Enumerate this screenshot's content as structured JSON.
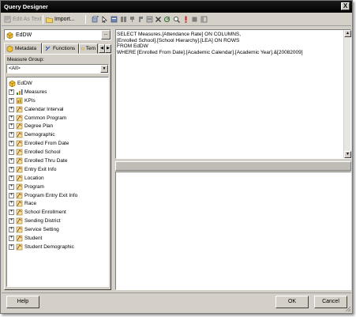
{
  "window": {
    "title": "Query Designer",
    "close_glyph": "X"
  },
  "toolbar": {
    "edit_as_text_label": "Edit As Text",
    "import_label": "Import...",
    "icons": [
      "pointer-icon",
      "cube-icon",
      "filter-icon",
      "auto-execute-icon",
      "exec-icon",
      "empty-cells-icon",
      "delete-icon",
      "refresh-icon",
      "find-icon",
      "run-icon",
      "stop-icon",
      "prepare-icon"
    ]
  },
  "metadata": {
    "cube_name": "EdDW",
    "cube_picker_glyph": "...",
    "tabs": [
      {
        "label": "Metadata"
      },
      {
        "label": "Functions"
      },
      {
        "label": "Tem"
      }
    ],
    "measure_group_label": "Measure Group:",
    "measure_group_value": "<All>",
    "tree_root": "EdDW",
    "tree_items": [
      {
        "label": "Measures",
        "icon": "measures-icon"
      },
      {
        "label": "KPIs",
        "icon": "kpi-icon"
      },
      {
        "label": "Calendar Interval",
        "icon": "dimension-icon"
      },
      {
        "label": "Common Program",
        "icon": "dimension-icon"
      },
      {
        "label": "Degree Plan",
        "icon": "dimension-icon"
      },
      {
        "label": "Demographic",
        "icon": "dimension-icon"
      },
      {
        "label": "Enrolled From Date",
        "icon": "dimension-icon"
      },
      {
        "label": "Enrolled School",
        "icon": "dimension-icon"
      },
      {
        "label": "Enrolled Thru Date",
        "icon": "dimension-icon"
      },
      {
        "label": "Entry Exit Info",
        "icon": "dimension-icon"
      },
      {
        "label": "Location",
        "icon": "dimension-icon"
      },
      {
        "label": "Program",
        "icon": "dimension-icon"
      },
      {
        "label": "Program Entry Exit Info",
        "icon": "dimension-icon"
      },
      {
        "label": "Race",
        "icon": "dimension-icon"
      },
      {
        "label": "School Enrollment",
        "icon": "dimension-icon"
      },
      {
        "label": "Sending District",
        "icon": "dimension-icon"
      },
      {
        "label": "Service Setting",
        "icon": "dimension-icon"
      },
      {
        "label": "Student",
        "icon": "dimension-icon"
      },
      {
        "label": "Student Demographic",
        "icon": "dimension-icon"
      }
    ]
  },
  "query": {
    "lines": [
      "SELECT Measures.[Attendance Rate] ON COLUMNS,",
      "[Enrolled School].[School Hierarchy].[LEA] ON ROWS",
      "FROM EdDW",
      "WHERE [Enrolled From Date].[Academic Calendar].[Academic Year].&[20082009]"
    ]
  },
  "buttons": {
    "help": "Help",
    "ok": "OK",
    "cancel": "Cancel"
  }
}
